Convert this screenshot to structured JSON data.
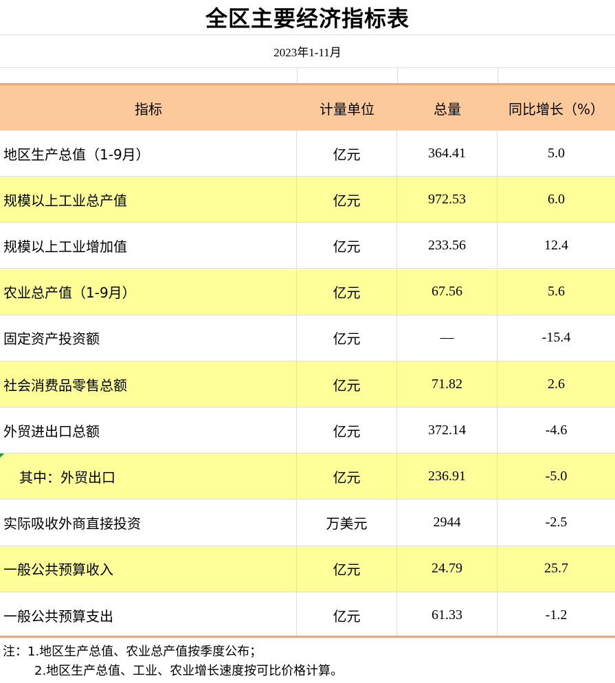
{
  "title": "全区主要经济指标表",
  "period": "2023年1-11月",
  "headers": {
    "indicator": "指标",
    "unit": "计量单位",
    "total": "总量",
    "growth": "同比增长（%）"
  },
  "rows": [
    {
      "indicator": "地区生产总值（1-9月）",
      "unit": "亿元",
      "total": "364.41",
      "growth": "5.0",
      "highlight": false
    },
    {
      "indicator": "规模以上工业总产值",
      "unit": "亿元",
      "total": "972.53",
      "growth": "6.0",
      "highlight": true
    },
    {
      "indicator": "规模以上工业增加值",
      "unit": "亿元",
      "total": "233.56",
      "growth": "12.4",
      "highlight": false
    },
    {
      "indicator": "农业总产值（1-9月）",
      "unit": "亿元",
      "total": "67.56",
      "growth": "5.6",
      "highlight": true
    },
    {
      "indicator": "固定资产投资额",
      "unit": "亿元",
      "total": "—",
      "growth": "-15.4",
      "highlight": false
    },
    {
      "indicator": "社会消费品零售总额",
      "unit": "亿元",
      "total": "71.82",
      "growth": "2.6",
      "highlight": true
    },
    {
      "indicator": "外贸进出口总额",
      "unit": "亿元",
      "total": "372.14",
      "growth": "-4.6",
      "highlight": false
    },
    {
      "indicator": "其中：外贸出口",
      "unit": "亿元",
      "total": "236.91",
      "growth": "-5.0",
      "highlight": true
    },
    {
      "indicator": "实际吸收外商直接投资",
      "unit": "万美元",
      "total": "2944",
      "growth": "-2.5",
      "highlight": false
    },
    {
      "indicator": "一般公共预算收入",
      "unit": "亿元",
      "total": "24.79",
      "growth": "25.7",
      "highlight": true
    },
    {
      "indicator": "一般公共预算支出",
      "unit": "亿元",
      "total": "61.33",
      "growth": "-1.2",
      "highlight": false
    }
  ],
  "notes": {
    "line1": "注：1.地区生产总值、农业总产值按季度公布；",
    "line2": "2.地区生产总值、工业、农业增长速度按可比价格计算。"
  },
  "colors": {
    "header_bg": "#fcc99b",
    "header_border": "#f4a66a",
    "highlight_row": "#ffff99",
    "grid": "#d9dde3",
    "cell_marker": "#1a9a3a"
  }
}
